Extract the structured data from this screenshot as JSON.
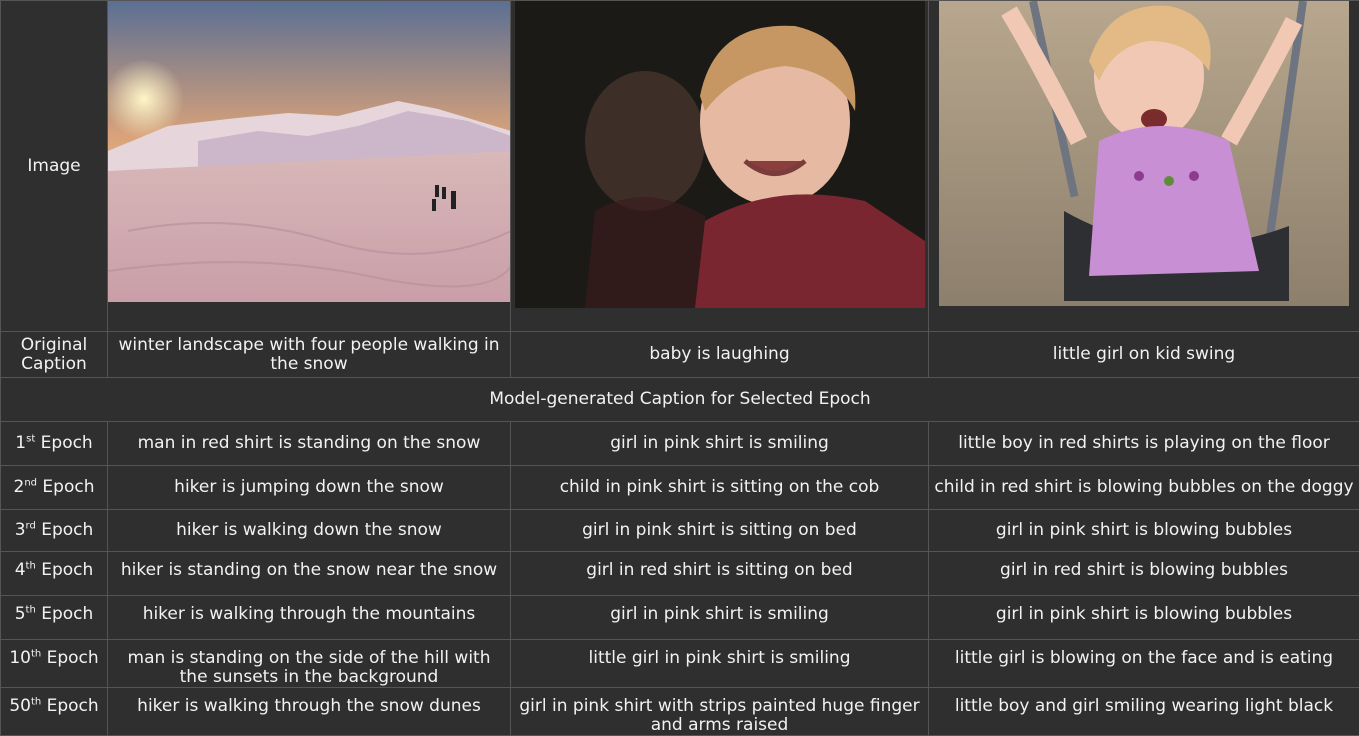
{
  "row_labels": {
    "image": "Image",
    "original_caption": "Original Caption"
  },
  "original_captions": [
    "winter landscape with four people walking in the snow",
    "baby is laughing",
    "little girl on kid swing"
  ],
  "section_header": "Model-generated Caption for Selected Epoch",
  "epochs": [
    {
      "num": "1",
      "sup": "st",
      "word": "Epoch",
      "captions": [
        "man in red shirt is standing on the snow",
        "girl in pink shirt is smiling",
        "little boy in red shirts is playing on the floor"
      ]
    },
    {
      "num": "2",
      "sup": "nd",
      "word": "Epoch",
      "captions": [
        "hiker is jumping down the snow",
        "child in pink shirt is sitting on the cob",
        "child in red shirt is blowing bubbles on the doggy"
      ]
    },
    {
      "num": "3",
      "sup": "rd",
      "word": "Epoch",
      "captions": [
        "hiker is walking down the snow",
        "girl in pink shirt is sitting on bed",
        "girl in pink shirt is blowing bubbles"
      ]
    },
    {
      "num": "4",
      "sup": "th",
      "word": "Epoch",
      "captions": [
        "hiker is standing on the snow near the snow",
        "girl in red shirt is sitting on bed",
        "girl in red shirt is blowing bubbles"
      ]
    },
    {
      "num": "5",
      "sup": "th",
      "word": "Epoch",
      "captions": [
        "hiker is walking through the mountains",
        "girl in pink shirt is smiling",
        "girl in pink shirt is blowing bubbles"
      ]
    },
    {
      "num": "10",
      "sup": "th",
      "word": "Epoch",
      "captions": [
        "man is standing on the side of the hill with the sunsets in the background",
        "little girl in pink shirt is smiling",
        "little girl is blowing on the face and is eating"
      ]
    },
    {
      "num": "50",
      "sup": "th",
      "word": "Epoch",
      "captions": [
        "hiker is walking through the snow dunes",
        "girl in pink shirt with strips painted huge finger and arms raised",
        "little boy and girl smiling wearing light black"
      ]
    }
  ],
  "colors": {
    "background": "#2f2f2f",
    "text": "#f2f2f2",
    "border": "#555555"
  }
}
